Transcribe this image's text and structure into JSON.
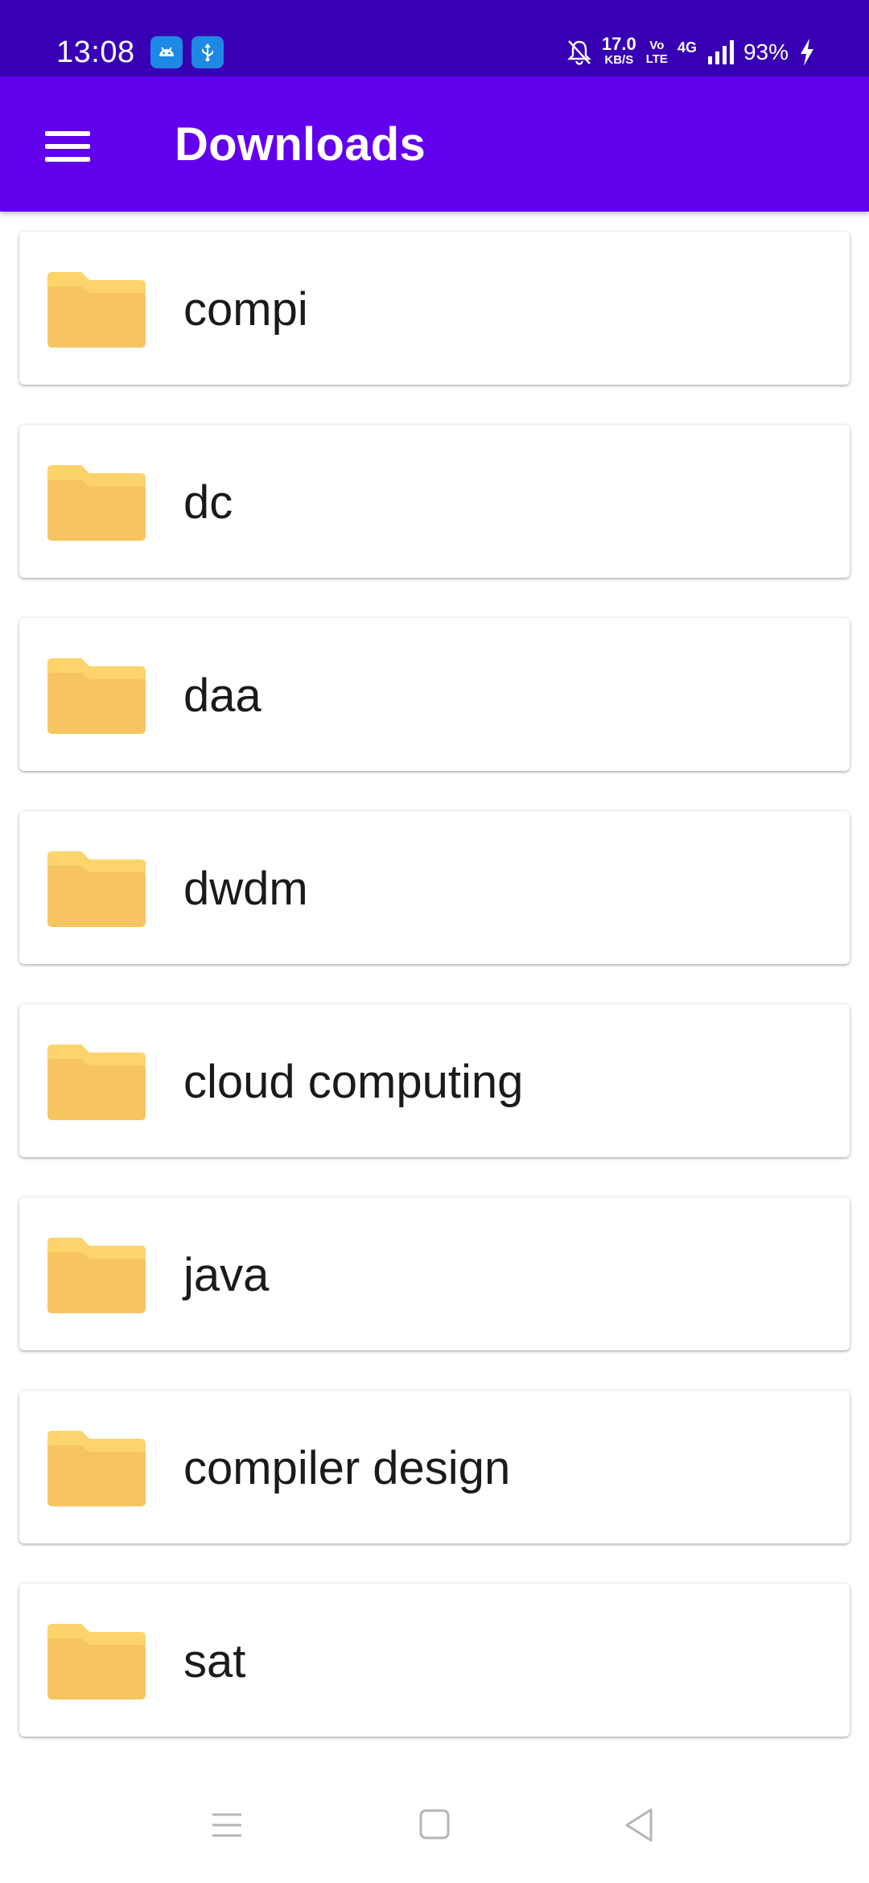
{
  "status_bar": {
    "time": "13:08",
    "speed_value": "17.0",
    "speed_unit": "KB/S",
    "volte_top": "Vo",
    "volte_bottom": "LTE",
    "network_type": "4G",
    "battery_percent": "93%",
    "icons": [
      "android-notification-icon",
      "usb-notification-icon",
      "bell-muted-icon",
      "signal-icon",
      "charging-icon"
    ]
  },
  "app_bar": {
    "title": "Downloads",
    "menu_icon": "hamburger-menu-icon"
  },
  "folders": [
    {
      "name": "compi",
      "icon": "folder-icon"
    },
    {
      "name": "dc",
      "icon": "folder-icon"
    },
    {
      "name": "daa",
      "icon": "folder-icon"
    },
    {
      "name": "dwdm",
      "icon": "folder-icon"
    },
    {
      "name": "cloud computing",
      "icon": "folder-icon"
    },
    {
      "name": "java",
      "icon": "folder-icon"
    },
    {
      "name": "compiler design",
      "icon": "folder-icon"
    },
    {
      "name": "sat",
      "icon": "folder-icon"
    }
  ],
  "nav_bar": {
    "icons": [
      "recents-icon",
      "home-icon",
      "back-icon"
    ]
  },
  "colors": {
    "status_bar": "#3700B3",
    "app_bar": "#6200EE",
    "folder_main": "#F6C55F",
    "folder_tab": "#FCD46B"
  }
}
